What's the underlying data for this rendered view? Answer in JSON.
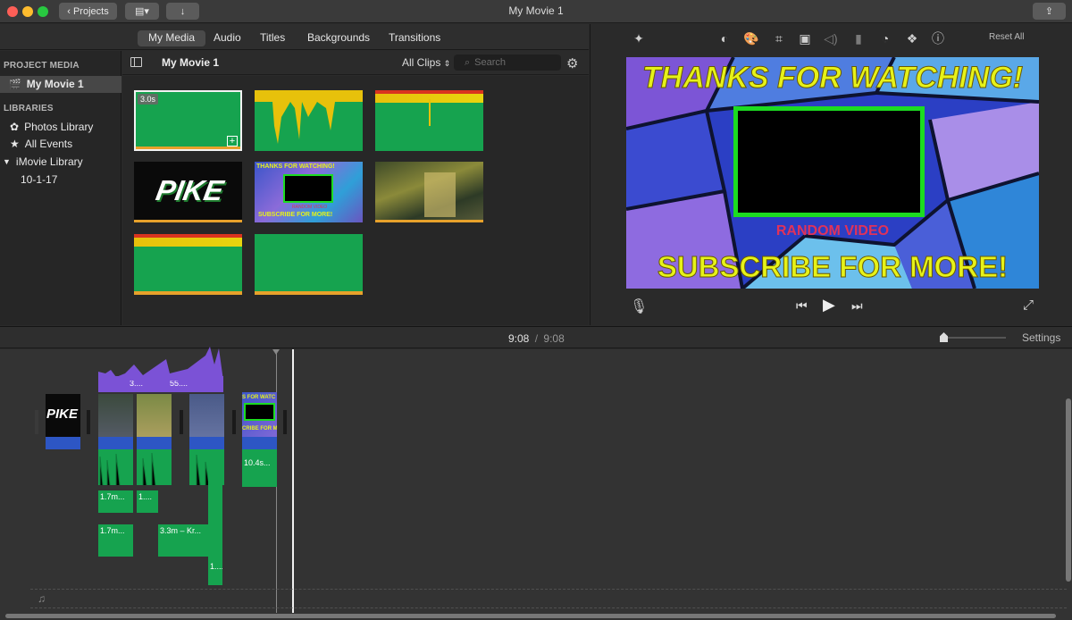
{
  "window": {
    "title": "My Movie 1",
    "projects_label": "Projects"
  },
  "tabs": [
    "My Media",
    "Audio",
    "Titles",
    "Backgrounds",
    "Transitions"
  ],
  "sidebar": {
    "project_media_header": "PROJECT MEDIA",
    "project_item": "My Movie 1",
    "libraries_header": "LIBRARIES",
    "items": [
      "Photos Library",
      "All Events",
      "iMovie Library",
      "10-1-17"
    ]
  },
  "browser": {
    "event_title": "My Movie 1",
    "filter": "All Clips",
    "search_placeholder": "Search",
    "first_clip_duration": "3.0s"
  },
  "viewer": {
    "reset_label": "Reset All",
    "preview_title": "THANKS FOR WATCHING!",
    "preview_mid": "RANDOM VIDEO",
    "preview_bottom": "SUBSCRIBE FOR MORE!"
  },
  "timeline": {
    "current_time": "9:08",
    "separator": "/",
    "total_time": "9:08",
    "settings_label": "Settings",
    "audio_labels": [
      "1.7m...",
      "1....",
      "1.7m...",
      "3.3m – Kr...",
      "10.4s...",
      "1...."
    ],
    "purple_labels": [
      "3....",
      "55...."
    ],
    "music_icon": "♫"
  },
  "colors": {
    "accent_green": "#16a34f",
    "purple": "#7b52d6",
    "neon_yellow": "#e6f219"
  }
}
